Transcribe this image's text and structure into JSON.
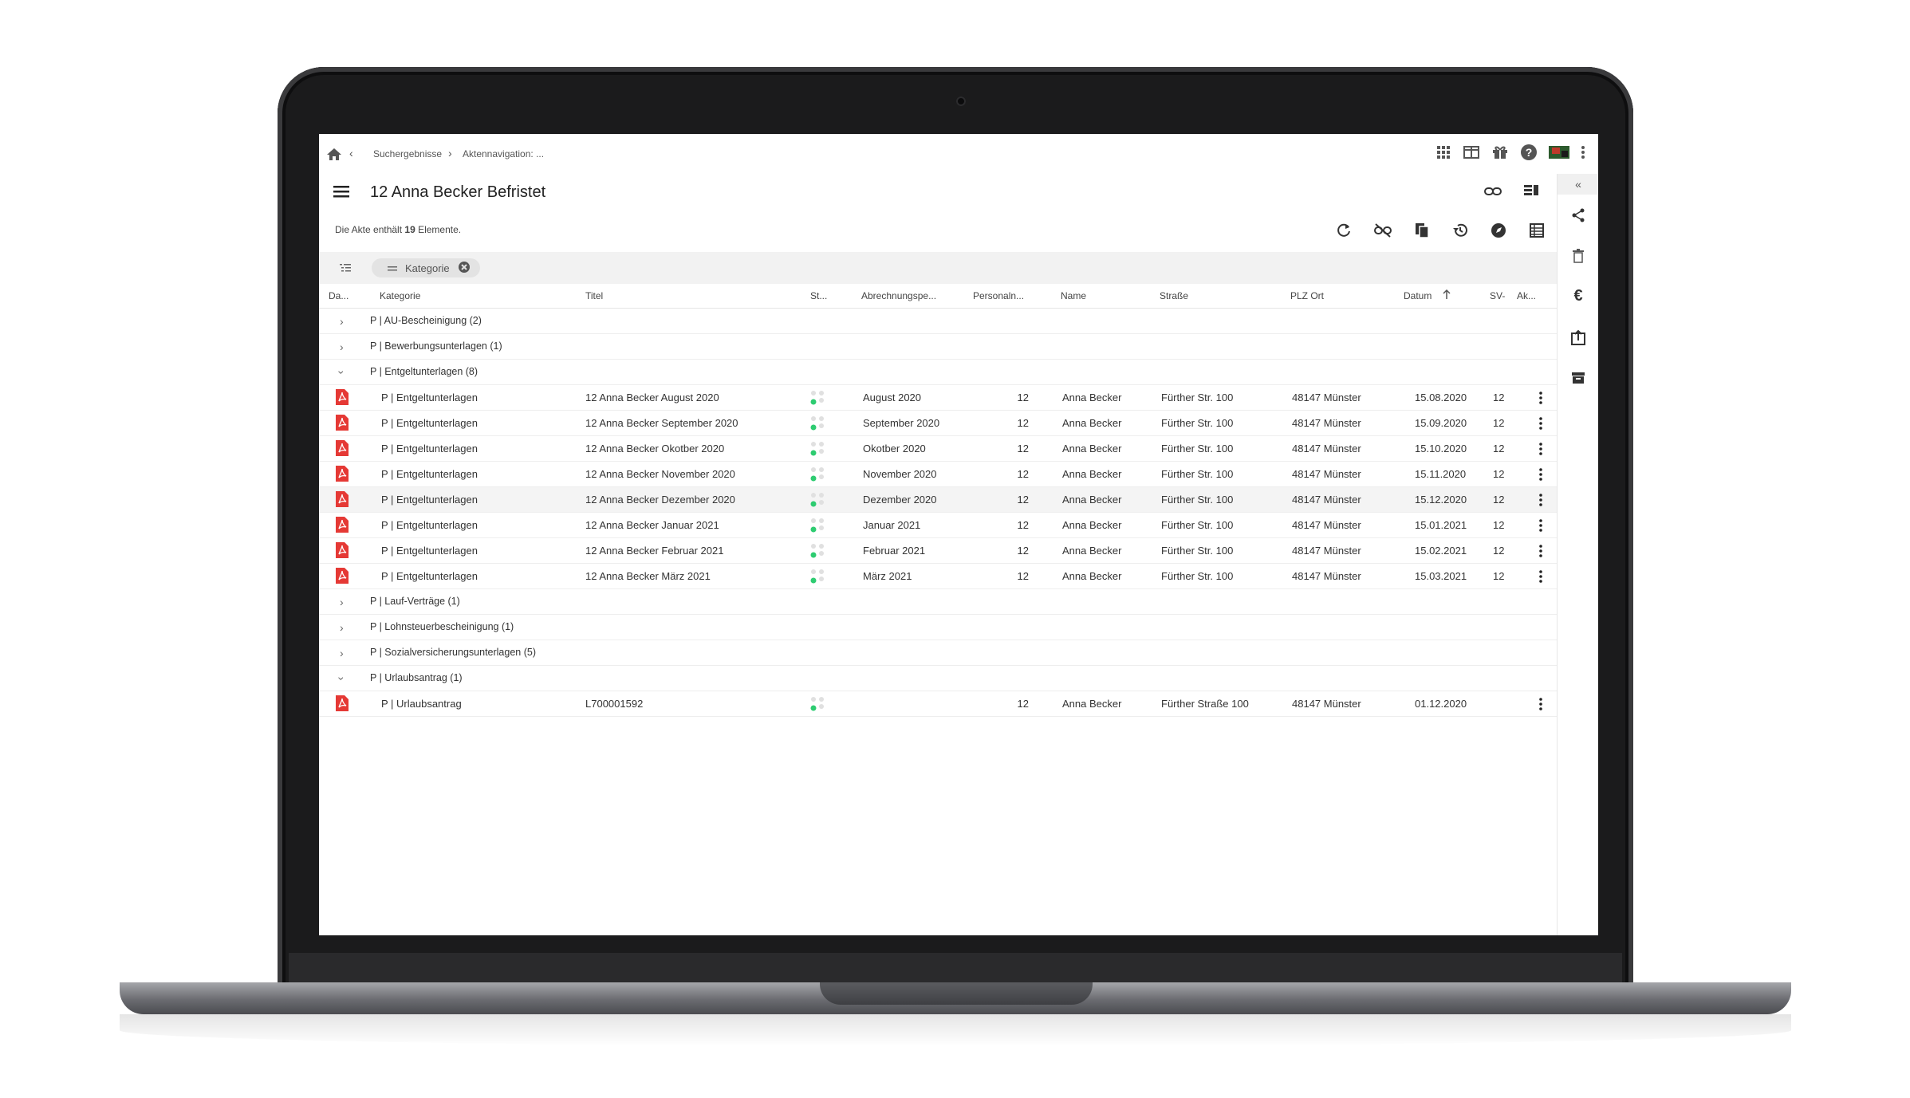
{
  "breadcrumb": {
    "items": [
      "Suchergebnisse",
      "Aktennavigation: ..."
    ]
  },
  "title": "12 Anna Becker Befristet",
  "summary": {
    "prefix": "Die Akte enthält ",
    "count": "19",
    "suffix": " Elemente."
  },
  "filter": {
    "chip_label": "Kategorie"
  },
  "columns": [
    "Da...",
    "Kategorie",
    "Titel",
    "St...",
    "Abrechnungspe...",
    "Personaln...",
    "Name",
    "Straße",
    "PLZ Ort",
    "Datum",
    "SV-",
    "Ak..."
  ],
  "groups": {
    "g1": "P | AU-Bescheinigung (2)",
    "g2": "P | Bewerbungsunterlagen (1)",
    "g3": "P | Entgeltunterlagen (8)",
    "g4": "P | Lauf-Verträge (1)",
    "g5": "P | Lohnsteuerbescheinigung (1)",
    "g6": "P | Sozialversicherungsunterlagen (5)",
    "g7": "P | Urlaubsantrag (1)"
  },
  "rows": [
    {
      "kategorie": "P | Entgeltunterlagen",
      "titel": "12 Anna Becker August 2020",
      "abrechnung": "August 2020",
      "personal": "12",
      "name": "Anna Becker",
      "strasse": "Fürther Str. 100",
      "plz": "48147 Münster",
      "datum": "15.08.2020",
      "sv": "12"
    },
    {
      "kategorie": "P | Entgeltunterlagen",
      "titel": "12 Anna Becker September 2020",
      "abrechnung": "September 2020",
      "personal": "12",
      "name": "Anna Becker",
      "strasse": "Fürther Str. 100",
      "plz": "48147 Münster",
      "datum": "15.09.2020",
      "sv": "12"
    },
    {
      "kategorie": "P | Entgeltunterlagen",
      "titel": "12 Anna Becker Okotber 2020",
      "abrechnung": "Okotber 2020",
      "personal": "12",
      "name": "Anna Becker",
      "strasse": "Fürther Str. 100",
      "plz": "48147 Münster",
      "datum": "15.10.2020",
      "sv": "12"
    },
    {
      "kategorie": "P | Entgeltunterlagen",
      "titel": "12 Anna Becker November 2020",
      "abrechnung": "November 2020",
      "personal": "12",
      "name": "Anna Becker",
      "strasse": "Fürther Str. 100",
      "plz": "48147 Münster",
      "datum": "15.11.2020",
      "sv": "12"
    },
    {
      "kategorie": "P | Entgeltunterlagen",
      "titel": "12 Anna Becker Dezember 2020",
      "abrechnung": "Dezember 2020",
      "personal": "12",
      "name": "Anna Becker",
      "strasse": "Fürther Str. 100",
      "plz": "48147 Münster",
      "datum": "15.12.2020",
      "sv": "12"
    },
    {
      "kategorie": "P | Entgeltunterlagen",
      "titel": "12 Anna Becker Januar 2021",
      "abrechnung": "Januar 2021",
      "personal": "12",
      "name": "Anna Becker",
      "strasse": "Fürther Str. 100",
      "plz": "48147 Münster",
      "datum": "15.01.2021",
      "sv": "12"
    },
    {
      "kategorie": "P | Entgeltunterlagen",
      "titel": "12 Anna Becker Februar 2021",
      "abrechnung": "Februar 2021",
      "personal": "12",
      "name": "Anna Becker",
      "strasse": "Fürther Str. 100",
      "plz": "48147 Münster",
      "datum": "15.02.2021",
      "sv": "12"
    },
    {
      "kategorie": "P | Entgeltunterlagen",
      "titel": "12 Anna Becker März 2021",
      "abrechnung": "März 2021",
      "personal": "12",
      "name": "Anna Becker",
      "strasse": "Fürther Str. 100",
      "plz": "48147 Münster",
      "datum": "15.03.2021",
      "sv": "12"
    },
    {
      "kategorie": "P | Urlaubsantrag",
      "titel": "L700001592",
      "abrechnung": "",
      "personal": "12",
      "name": "Anna Becker",
      "strasse": "Fürther Straße 100",
      "plz": "48147 Münster",
      "datum": "01.12.2020",
      "sv": ""
    }
  ],
  "right_panel": {
    "collapse_label": "«",
    "euro_label": "€"
  },
  "colors": {
    "pdf_red": "#e53935",
    "status_green": "#2ecc71",
    "status_gray": "#e0e0e0"
  }
}
